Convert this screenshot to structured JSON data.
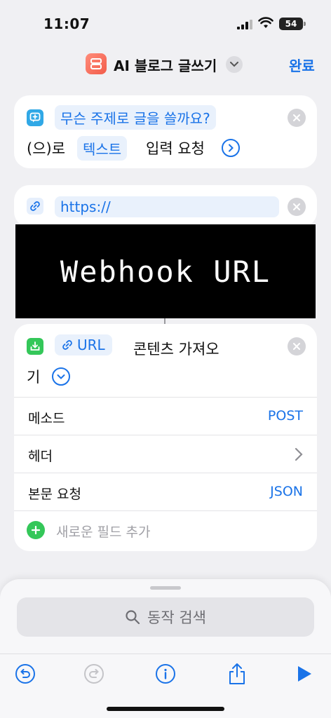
{
  "status_bar": {
    "time": "11:07",
    "battery": "54"
  },
  "nav": {
    "title": "AI 블로그 글쓰기",
    "done_label": "완료"
  },
  "ask_action": {
    "prompt_token": "무슨 주제로 글을 쓸까요?",
    "suffix_text": "(으)로",
    "type_token": "텍스트",
    "action_text": "입력 요청"
  },
  "url_action": {
    "url_token": "https://"
  },
  "overlay": {
    "text": "Webhook URL"
  },
  "get_contents_action": {
    "url_token": "URL",
    "title_line1": "콘텐츠 가져오",
    "title_line2": "기",
    "rows": [
      {
        "label": "메소드",
        "value": "POST"
      },
      {
        "label": "헤더",
        "value": ""
      },
      {
        "label": "본문 요청",
        "value": "JSON"
      }
    ],
    "add_field_label": "새로운 필드 추가"
  },
  "sheet": {
    "search_placeholder": "동작 검색"
  },
  "colors": {
    "accent": "#1a73e8",
    "add_green": "#34c759",
    "app_icon": "#f25c4a"
  }
}
